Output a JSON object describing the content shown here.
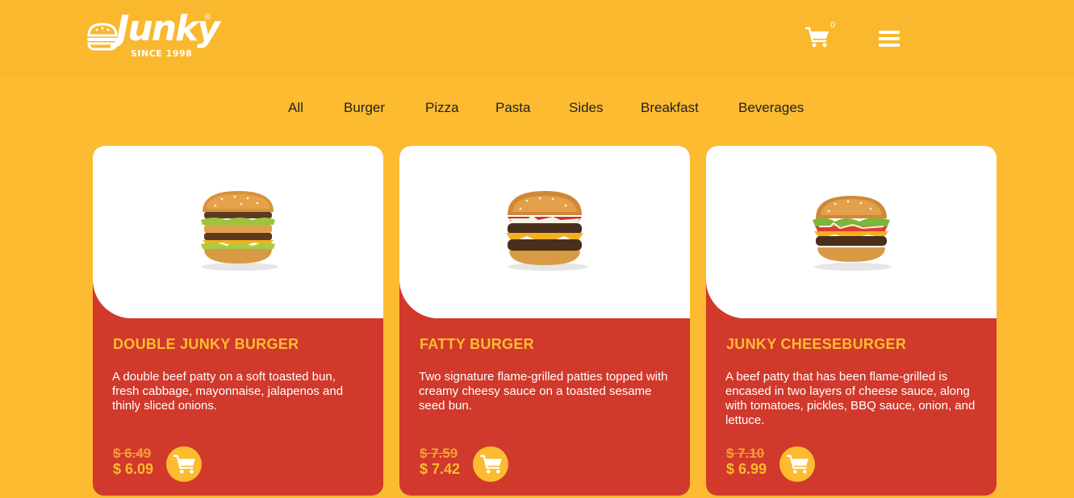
{
  "brand": {
    "name": "Junky",
    "tagline": "SINCE 1998",
    "registered": "®"
  },
  "header": {
    "cart_count": "0"
  },
  "categories": [
    "All",
    "Burger",
    "Pizza",
    "Pasta",
    "Sides",
    "Breakfast",
    "Beverages"
  ],
  "products": [
    {
      "name": "DOUBLE JUNKY BURGER",
      "description": "A double beef patty on a soft toasted bun, fresh cabbage, mayonnaise, jalapenos and thinly sliced onions.",
      "old_price": "$ 6.49",
      "price": "$ 6.09",
      "icon": "cart-icon"
    },
    {
      "name": "FATTY BURGER",
      "description": "Two signature flame-grilled patties topped with creamy cheesy sauce on a toasted sesame seed bun.",
      "old_price": "$ 7.59",
      "price": "$ 7.42",
      "icon": "cart-icon"
    },
    {
      "name": "JUNKY CHEESEBURGER",
      "description": "A beef patty that has been flame-grilled is encased in two layers of cheese sauce, along with tomatoes, pickles, BBQ sauce, onion, and lettuce.",
      "old_price": "$ 7.10",
      "price": "$ 6.99",
      "icon": "cart-icon"
    }
  ],
  "colors": {
    "background": "#fcbb30",
    "card": "#d0392b",
    "accent": "#fcbb30",
    "strike": "#f3a037"
  }
}
